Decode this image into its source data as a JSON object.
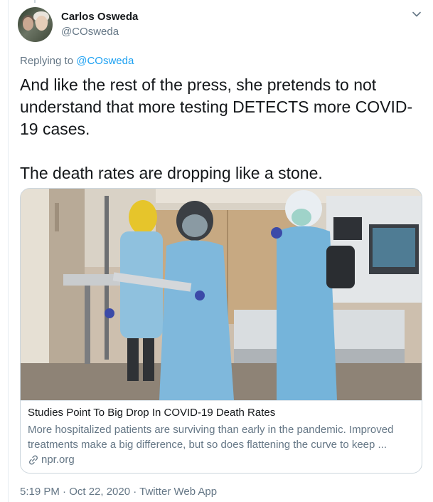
{
  "author": {
    "display_name": "Carlos Osweda",
    "handle": "@COsweda"
  },
  "replying": {
    "prefix": "Replying to ",
    "target": "@COsweda"
  },
  "tweet": {
    "text": "And like the rest of the press, she pretends to not understand that more testing DETECTS more COVID-19 cases.\n\nThe death rates are dropping like a stone."
  },
  "card": {
    "title": "Studies Point To Big Drop In COVID-19 Death Rates",
    "description": "More hospitalized patients are surviving than early in the pandemic. Improved treatments make a big difference, but so does flattening the curve to keep ...",
    "domain": "npr.org"
  },
  "meta": {
    "timestamp": "5:19 PM · Oct 22, 2020 · Twitter Web App"
  },
  "colors": {
    "link": "#1da1f2",
    "secondary_text": "#657786",
    "border": "#ccd6dd"
  },
  "icons": [
    "chevron-down-icon",
    "link-icon"
  ]
}
